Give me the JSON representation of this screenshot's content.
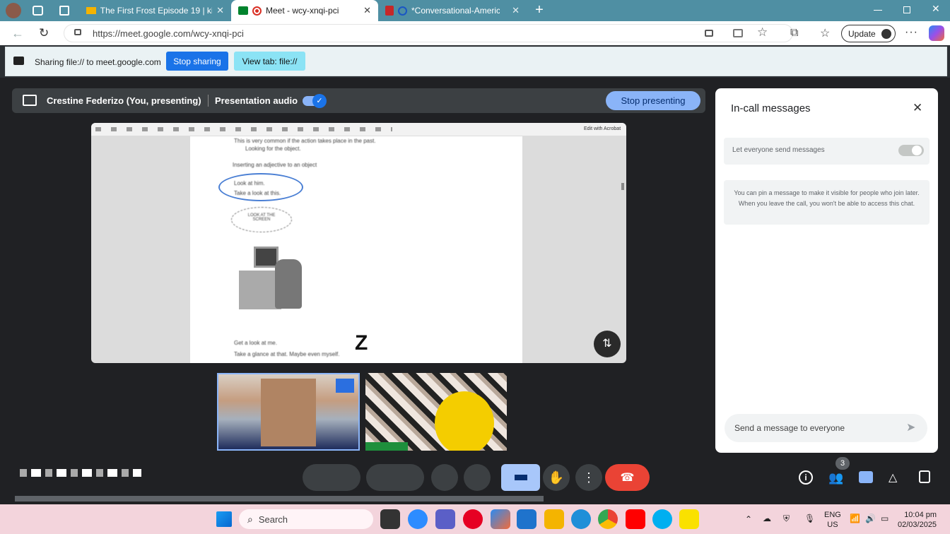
{
  "browser": {
    "tabs": [
      {
        "title": "The First Frost Episode 19 | kisskh",
        "active": false
      },
      {
        "title": "Meet - wcy-xnqi-pci",
        "active": true
      },
      {
        "title": "*Conversational-American-E",
        "active": false
      }
    ],
    "url": "https://meet.google.com/wcy-xnqi-pci",
    "update_label": "Update"
  },
  "share_bar": {
    "text": "Sharing file:// to meet.google.com",
    "stop_sharing": "Stop sharing",
    "view_tab": "View tab: file://"
  },
  "meet": {
    "presenter": "Crestine Federizo (You, presenting)",
    "presentation_audio": "Presentation audio",
    "audio_enabled": true,
    "stop_presenting": "Stop presenting",
    "pdf": {
      "edit_with_acrobat": "Edit with Acrobat",
      "line1": "This is very common if the action takes place in the past.",
      "line2": "Looking for the object.",
      "line3": "Inserting an adjective to an object",
      "bubble1": [
        "Look at him.",
        "Take a look at this."
      ],
      "bubble2": "LOOK AT THE SCREEN",
      "bottom1": "Get a look at me.",
      "bottom2": "Take a glance at that. Maybe even myself."
    },
    "participants_count": "3",
    "icons": [
      "hand-icon",
      "more-icon",
      "end-call-icon",
      "info-icon",
      "people-icon",
      "chat-icon",
      "activities-icon",
      "lock-icon"
    ]
  },
  "chat": {
    "title": "In-call messages",
    "toggle_label": "Let everyone send messages",
    "info": "You can pin a message to make it visible for people who join later. When you leave the call, you won't be able to access this chat.",
    "placeholder": "Send a message to everyone"
  },
  "taskbar": {
    "search": "Search",
    "lang": "ENG",
    "region": "US",
    "time": "10:04 pm",
    "date": "02/03/2025"
  }
}
